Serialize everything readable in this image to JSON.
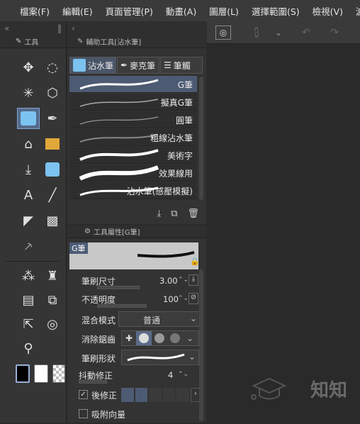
{
  "menu": [
    "檔案(F)",
    "編輯(E)",
    "頁面管理(P)",
    "動畫(A)",
    "圖層(L)",
    "選擇範圍(S)",
    "檢視(V)",
    "濾"
  ],
  "tool_panel": {
    "title": "工具"
  },
  "sub_tool_panel": {
    "title": "輔助工具[沾水筆]",
    "tabs": [
      "沾水筆",
      "麥克筆",
      "筆觸"
    ],
    "brushes": [
      "G筆",
      "擬真G筆",
      "圓筆",
      "粗線沾水筆",
      "美術字",
      "效果線用",
      "沾水筆(感壓模擬)"
    ],
    "selected_brush": "G筆"
  },
  "tool_property": {
    "title": "工具屬性[G筆]",
    "preview_label": "G筆",
    "brush_size_label": "筆刷尺寸",
    "brush_size_value": "3.00",
    "opacity_label": "不透明度",
    "opacity_value": "100",
    "blend_label": "混合模式",
    "blend_value": "普通",
    "antialias_label": "消除鋸齒",
    "brush_shape_label": "筆刷形狀",
    "stabilization_label": "抖動修正",
    "stabilization_value": "4",
    "post_correction_label": "後修正",
    "snap_vector_label": "吸附向量"
  },
  "watermark": "知知",
  "colors": {
    "accent": "#4d5a73",
    "selected_tool": "#556a8a"
  }
}
